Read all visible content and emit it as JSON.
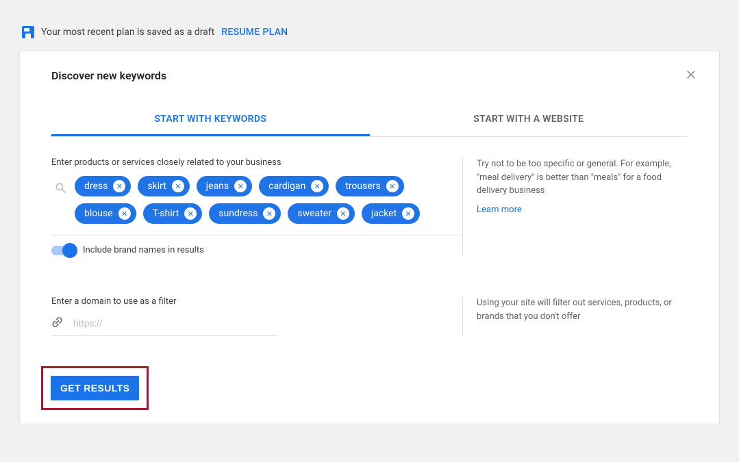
{
  "draft_banner": {
    "text": "Your most recent plan is saved as a draft",
    "resume_label": "RESUME PLAN"
  },
  "card": {
    "title": "Discover new keywords",
    "tabs": {
      "keywords": "START WITH KEYWORDS",
      "website": "START WITH A WEBSITE"
    },
    "section1": {
      "label": "Enter products or services closely related to your business",
      "chips": [
        "dress",
        "skirt",
        "jeans",
        "cardigan",
        "trousers",
        "blouse",
        "T-shirt",
        "sundress",
        "sweater",
        "jacket"
      ],
      "hint": "Try not to be too specific or general. For example, \"meal delivery\" is better than \"meals\" for a food delivery business",
      "learn_more": "Learn more",
      "toggle_label": "Include brand names in results",
      "toggle_on": true
    },
    "section2": {
      "label": "Enter a domain to use as a filter",
      "placeholder": "https://",
      "hint": "Using your site will filter out services, products, or brands that you don't offer"
    },
    "submit_label": "GET RESULTS"
  }
}
